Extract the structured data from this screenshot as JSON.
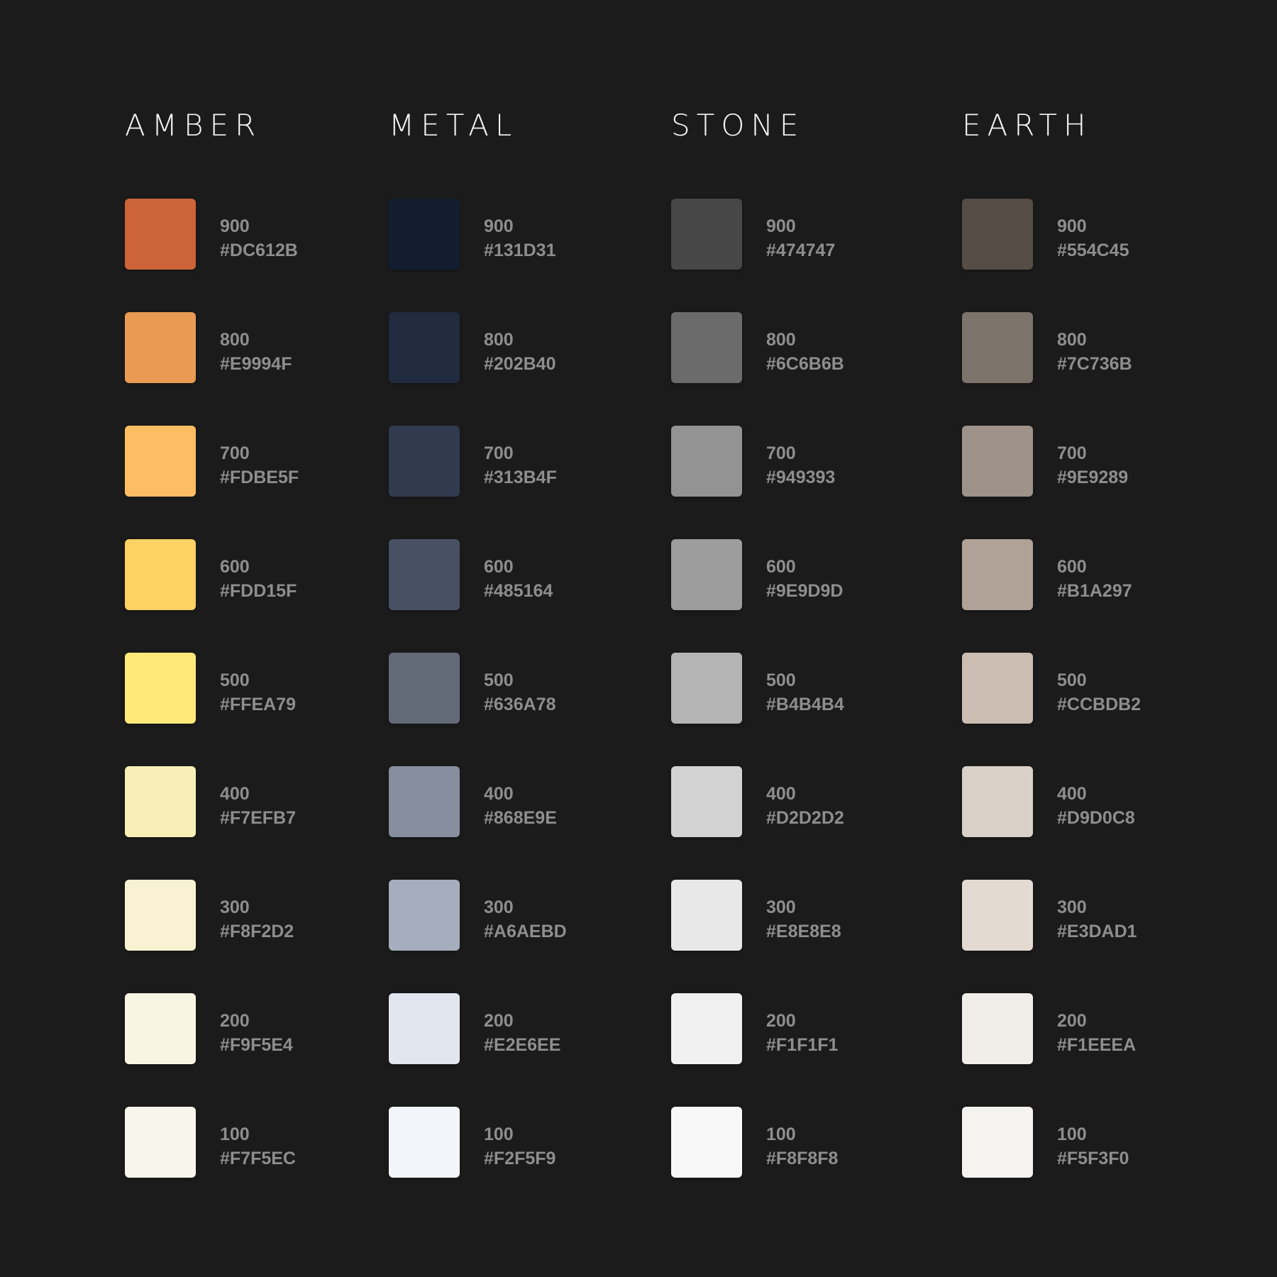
{
  "palettes": [
    {
      "name": "AMBER",
      "swatches": [
        {
          "shade": "900",
          "hex": "#DC612B",
          "color": "#CD6439"
        },
        {
          "shade": "800",
          "hex": "#E9994F",
          "color": "#E99A53"
        },
        {
          "shade": "700",
          "hex": "#FDBE5F",
          "color": "#FDBE63"
        },
        {
          "shade": "600",
          "hex": "#FDD15F",
          "color": "#FDD162"
        },
        {
          "shade": "500",
          "hex": "#FFEA79",
          "color": "#FFEA79"
        },
        {
          "shade": "400",
          "hex": "#F7EFB7",
          "color": "#F7EFB7"
        },
        {
          "shade": "300",
          "hex": "#F8F2D2",
          "color": "#F8F2D2"
        },
        {
          "shade": "200",
          "hex": "#F9F5E4",
          "color": "#F9F5E4"
        },
        {
          "shade": "100",
          "hex": "#F7F5EC",
          "color": "#F7F5EC"
        }
      ]
    },
    {
      "name": "METAL",
      "swatches": [
        {
          "shade": "900",
          "hex": "#131D31",
          "color": "#131D31"
        },
        {
          "shade": "800",
          "hex": "#202B40",
          "color": "#202B40"
        },
        {
          "shade": "700",
          "hex": "#313B4F",
          "color": "#313B4F"
        },
        {
          "shade": "600",
          "hex": "#485164",
          "color": "#485164"
        },
        {
          "shade": "500",
          "hex": "#636A78",
          "color": "#636A78"
        },
        {
          "shade": "400",
          "hex": "#868E9E",
          "color": "#868E9E"
        },
        {
          "shade": "300",
          "hex": "#A6AEBD",
          "color": "#A6AEBD"
        },
        {
          "shade": "200",
          "hex": "#E2E6EE",
          "color": "#E2E6EE"
        },
        {
          "shade": "100",
          "hex": "#F2F5F9",
          "color": "#F2F5F9"
        }
      ]
    },
    {
      "name": "STONE",
      "swatches": [
        {
          "shade": "900",
          "hex": "#474747",
          "color": "#474747"
        },
        {
          "shade": "800",
          "hex": "#6C6B6B",
          "color": "#6C6B6B"
        },
        {
          "shade": "700",
          "hex": "#949393",
          "color": "#949393"
        },
        {
          "shade": "600",
          "hex": "#9E9D9D",
          "color": "#9E9D9D"
        },
        {
          "shade": "500",
          "hex": "#B4B4B4",
          "color": "#B4B4B4"
        },
        {
          "shade": "400",
          "hex": "#D2D2D2",
          "color": "#D2D2D2"
        },
        {
          "shade": "300",
          "hex": "#E8E8E8",
          "color": "#E8E8E8"
        },
        {
          "shade": "200",
          "hex": "#F1F1F1",
          "color": "#F1F1F1"
        },
        {
          "shade": "100",
          "hex": "#F8F8F8",
          "color": "#F8F8F8"
        }
      ]
    },
    {
      "name": "EARTH",
      "swatches": [
        {
          "shade": "900",
          "hex": "#554C45",
          "color": "#554C45"
        },
        {
          "shade": "800",
          "hex": "#7C736B",
          "color": "#7C736B"
        },
        {
          "shade": "700",
          "hex": "#9E9289",
          "color": "#9E9289"
        },
        {
          "shade": "600",
          "hex": "#B1A297",
          "color": "#B1A297"
        },
        {
          "shade": "500",
          "hex": "#CCBDB2",
          "color": "#CCBDB2"
        },
        {
          "shade": "400",
          "hex": "#D9D0C8",
          "color": "#D9D0C8"
        },
        {
          "shade": "300",
          "hex": "#E3DAD1",
          "color": "#E3DAD1"
        },
        {
          "shade": "200",
          "hex": "#F1EEEA",
          "color": "#F1EEEA"
        },
        {
          "shade": "100",
          "hex": "#F5F3F0",
          "color": "#F5F3F0"
        }
      ]
    }
  ]
}
